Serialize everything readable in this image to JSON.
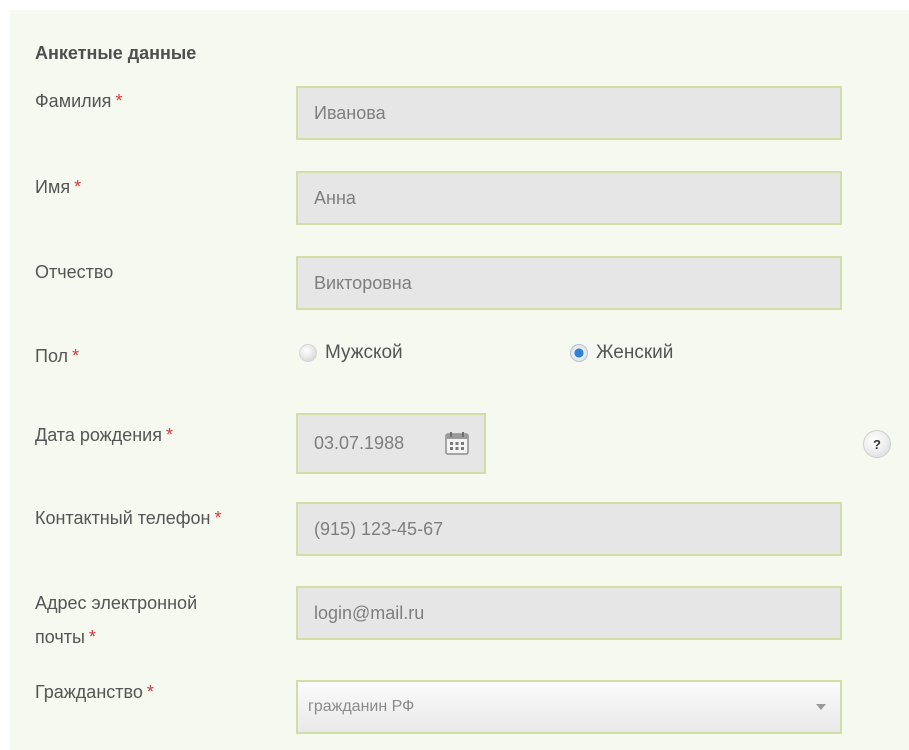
{
  "form": {
    "section_title": "Анкетные данные",
    "required_mark": "*"
  },
  "fields": {
    "surname": {
      "label": "Фамилия",
      "value": "Иванова"
    },
    "name": {
      "label": "Имя",
      "value": "Анна"
    },
    "patronymic": {
      "label": "Отчество",
      "value": "Викторовна"
    },
    "gender": {
      "label": "Пол",
      "options": [
        "Мужской",
        "Женский"
      ],
      "selected": "Женский"
    },
    "birth_date": {
      "label": "Дата рождения",
      "value": "03.07.1988"
    },
    "phone": {
      "label": "Контактный телефон",
      "value": "(915) 123-45-67"
    },
    "email": {
      "label_line1": "Адрес электронной",
      "label_line2": "почты",
      "value": "login@mail.ru"
    },
    "citizenship": {
      "label": "Гражданство",
      "value": "гражданин РФ"
    }
  },
  "help": {
    "symbol": "?"
  },
  "icons": {
    "calendar": "calendar-icon",
    "help": "help-icon",
    "dropdown": "chevron-down-icon"
  },
  "colors": {
    "panel_bg": "#f5f9ef",
    "field_border": "#d2dea6",
    "field_bg": "#e6e6e6",
    "required": "#d73a3a",
    "radio_selected": "#2f7fd6"
  }
}
